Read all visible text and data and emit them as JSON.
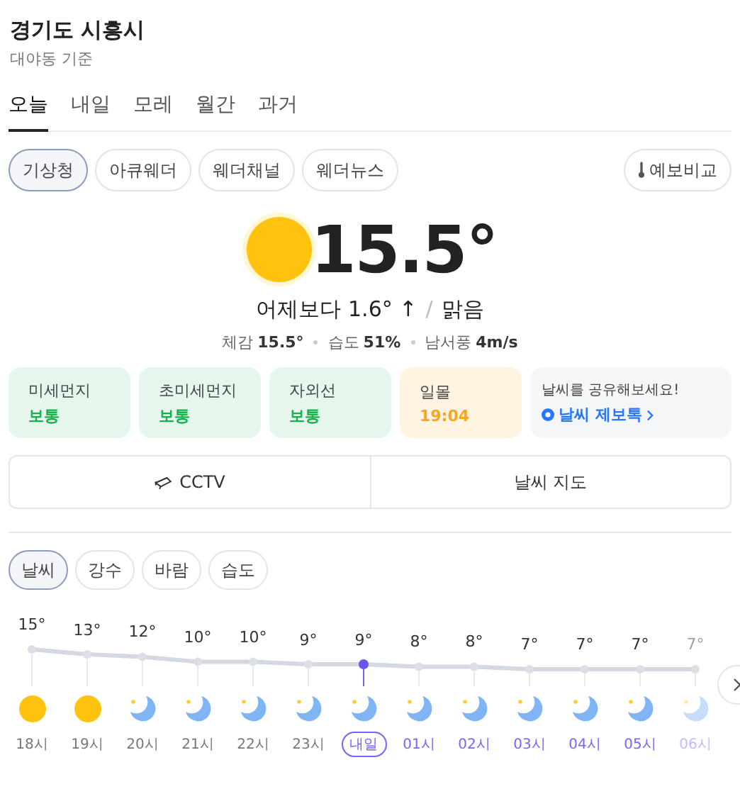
{
  "location": {
    "title": "경기도 시흥시",
    "subtitle": "대야동 기준"
  },
  "tabs": [
    {
      "label": "오늘",
      "selected": true
    },
    {
      "label": "내일",
      "selected": false
    },
    {
      "label": "모레",
      "selected": false
    },
    {
      "label": "월간",
      "selected": false
    },
    {
      "label": "과거",
      "selected": false
    }
  ],
  "sources": [
    {
      "label": "기상청",
      "selected": true
    },
    {
      "label": "아큐웨더",
      "selected": false
    },
    {
      "label": "웨더채널",
      "selected": false
    },
    {
      "label": "웨더뉴스",
      "selected": false
    }
  ],
  "compare_button": "예보비교",
  "current": {
    "temperature": "15.5°",
    "compare": "어제보다 1.6° ↑",
    "separator": "/",
    "condition": "맑음",
    "details": [
      {
        "label": "체감",
        "value": "15.5°"
      },
      {
        "label": "습도",
        "value": "51%"
      },
      {
        "label": "남서풍",
        "value": "4m/s"
      }
    ]
  },
  "cards": [
    {
      "kind": "green",
      "label": "미세먼지",
      "value": "보통"
    },
    {
      "kind": "green",
      "label": "초미세먼지",
      "value": "보통"
    },
    {
      "kind": "green",
      "label": "자외선",
      "value": "보통"
    },
    {
      "kind": "orange",
      "label": "일몰",
      "value": "19:04"
    },
    {
      "kind": "share",
      "label": "날씨를 공유해보세요!",
      "value": "날씨 제보톡"
    }
  ],
  "links": [
    {
      "label": "CCTV",
      "kind": "cctv"
    },
    {
      "label": "날씨 지도",
      "kind": "map"
    }
  ],
  "chart_tabs": [
    {
      "label": "날씨",
      "selected": true
    },
    {
      "label": "강수",
      "selected": false
    },
    {
      "label": "바람",
      "selected": false
    },
    {
      "label": "습도",
      "selected": false
    }
  ],
  "hours": [
    {
      "temp": "15°",
      "time": "18시",
      "kind": "clear_day",
      "day_start": false,
      "tomorrow": false
    },
    {
      "temp": "13°",
      "time": "19시",
      "kind": "clear_day",
      "day_start": false,
      "tomorrow": false
    },
    {
      "temp": "12°",
      "time": "20시",
      "kind": "clear_night",
      "day_start": false,
      "tomorrow": false
    },
    {
      "temp": "10°",
      "time": "21시",
      "kind": "clear_night",
      "day_start": false,
      "tomorrow": false
    },
    {
      "temp": "10°",
      "time": "22시",
      "kind": "clear_night",
      "day_start": false,
      "tomorrow": false
    },
    {
      "temp": "9°",
      "time": "23시",
      "kind": "clear_night",
      "day_start": false,
      "tomorrow": false
    },
    {
      "temp": "9°",
      "time": "내일",
      "kind": "clear_night",
      "day_start": true,
      "tomorrow": true
    },
    {
      "temp": "8°",
      "time": "01시",
      "kind": "clear_night",
      "day_start": false,
      "tomorrow": true
    },
    {
      "temp": "8°",
      "time": "02시",
      "kind": "clear_night",
      "day_start": false,
      "tomorrow": true
    },
    {
      "temp": "7°",
      "time": "03시",
      "kind": "clear_night",
      "day_start": false,
      "tomorrow": true
    },
    {
      "temp": "7°",
      "time": "04시",
      "kind": "clear_night",
      "day_start": false,
      "tomorrow": true
    },
    {
      "temp": "7°",
      "time": "05시",
      "kind": "clear_night",
      "day_start": false,
      "tomorrow": true
    },
    {
      "temp": "7°",
      "time": "06시",
      "kind": "clear_night",
      "day_start": false,
      "tomorrow": true
    }
  ]
}
